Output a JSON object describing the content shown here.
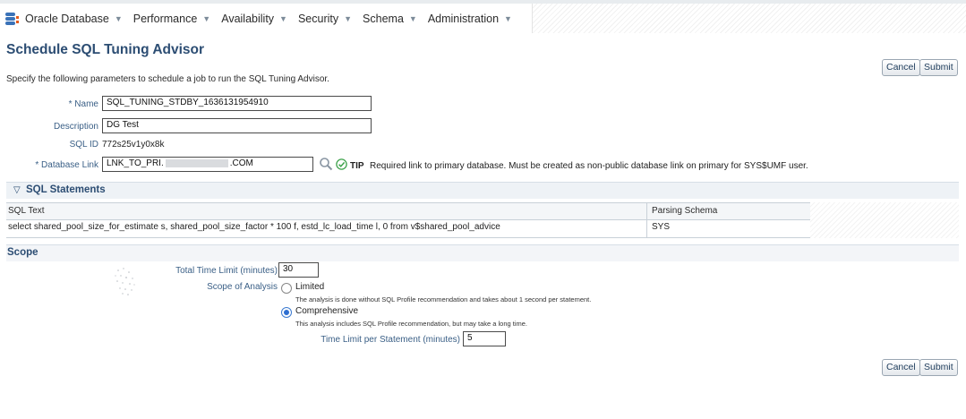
{
  "menubar": {
    "items": [
      {
        "label": "Oracle Database"
      },
      {
        "label": "Performance"
      },
      {
        "label": "Availability"
      },
      {
        "label": "Security"
      },
      {
        "label": "Schema"
      },
      {
        "label": "Administration"
      }
    ]
  },
  "page": {
    "title": "Schedule SQL Tuning Advisor",
    "instruction": "Specify the following parameters to schedule a job to run the SQL Tuning Advisor.",
    "cancel_label": "Cancel",
    "submit_label": "Submit"
  },
  "form": {
    "name_label": "* Name",
    "name_value": "SQL_TUNING_STDBY_1636131954910",
    "description_label": "Description",
    "description_value": "DG Test",
    "sqlid_label": "SQL ID",
    "sqlid_value": "772s25v1y0x8k",
    "dblink_label": "* Database Link",
    "dblink_value_prefix": "LNK_TO_PRI.",
    "dblink_value_suffix": ".COM",
    "tip_label": "TIP",
    "tip_text": "Required link to primary database. Must be created as non-public database link on primary for SYS$UMF user."
  },
  "sql_statements": {
    "title": "SQL Statements",
    "columns": [
      "SQL Text",
      "Parsing Schema"
    ],
    "rows": [
      {
        "sql_text": "select shared_pool_size_for_estimate s, shared_pool_size_factor * 100 f, estd_lc_load_time l, 0 from v$shared_pool_advice",
        "schema": "SYS"
      }
    ]
  },
  "scope": {
    "title": "Scope",
    "total_time_label": "Total Time Limit (minutes)",
    "total_time_value": "30",
    "scope_label": "Scope of Analysis",
    "limited_label": "Limited",
    "limited_desc": "The analysis is done without SQL Profile recommendation and takes about 1 second per statement.",
    "comprehensive_label": "Comprehensive",
    "comprehensive_desc": "This analysis includes SQL Profile recommendation, but may take a long time.",
    "selected": "Comprehensive",
    "per_statement_label": "Time Limit per Statement (minutes)",
    "per_statement_value": "5"
  },
  "colors": {
    "title": "#2c4d73",
    "label": "#3a5f86",
    "radio_on": "#2f6fd1",
    "tip_check": "#3fa34d"
  },
  "icons": {
    "search": "magnifier-icon",
    "tip": "checkmark-icon",
    "section": "triangle-down-icon",
    "db": "database-icon"
  }
}
